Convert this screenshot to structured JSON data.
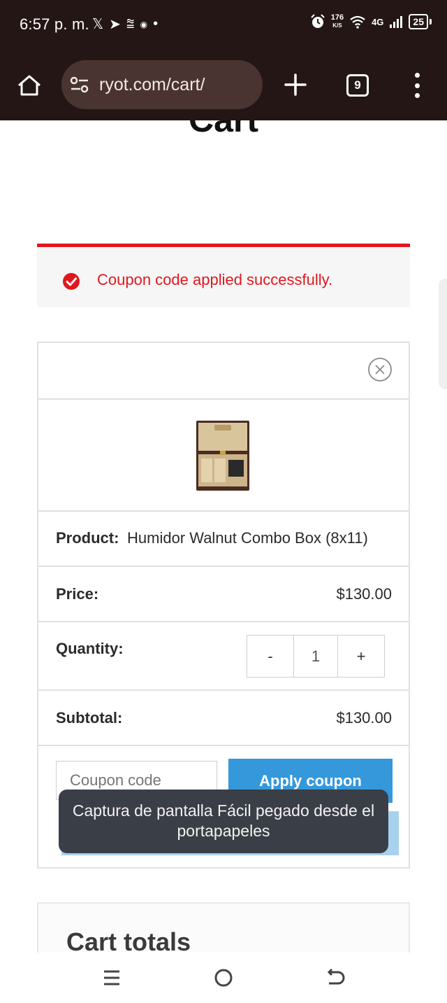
{
  "status_bar": {
    "time": "6:57 p. m.",
    "left_icons": [
      "𝕏",
      "➤",
      "⩰",
      "◉",
      "•"
    ],
    "speed_value": "176",
    "speed_unit": "K/S",
    "network": "4G",
    "battery": "25"
  },
  "browser": {
    "url": "ryot.com/cart/",
    "tab_count": "9"
  },
  "page": {
    "title": "Cart",
    "notice": "Coupon code applied successfully.",
    "cart": {
      "product_label": "Product:",
      "product_name": "Humidor Walnut Combo Box (8x11)",
      "price_label": "Price:",
      "price_value": "$130.00",
      "quantity_label": "Quantity:",
      "qty_minus": "-",
      "qty_value": "1",
      "qty_plus": "+",
      "subtotal_label": "Subtotal:",
      "subtotal_value": "$130.00",
      "coupon_placeholder": "Coupon code",
      "apply_coupon": "Apply coupon"
    },
    "totals_title": "Cart totals"
  },
  "toast": "Captura de pantalla Fácil pegado desde el portapapeles",
  "colors": {
    "chrome_bg": "#231614",
    "accent_red": "#e2171d",
    "button_blue": "#3498db"
  }
}
